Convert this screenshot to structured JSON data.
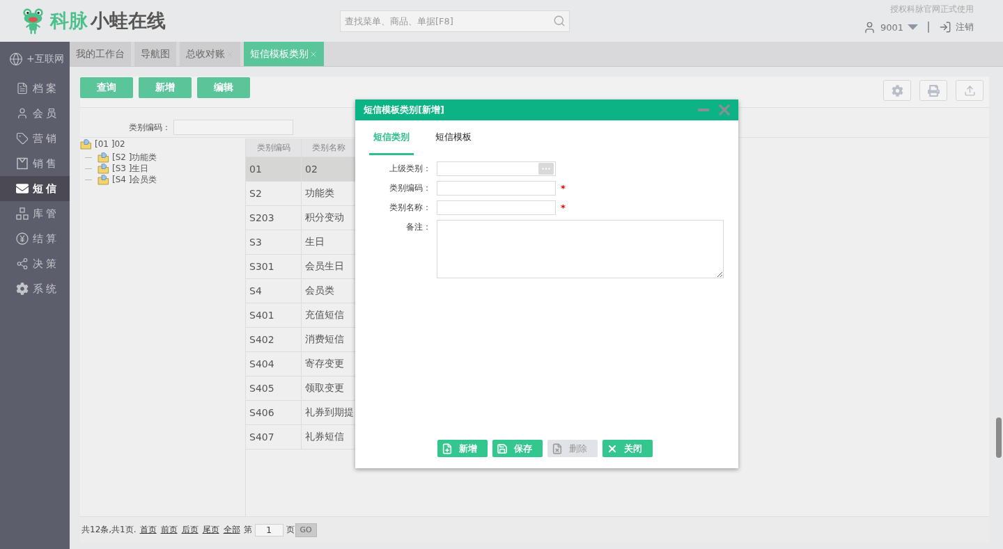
{
  "header": {
    "logo": {
      "brand": "科脉",
      "product": "小蛙在线"
    },
    "search": {
      "placeholder": "查找菜单、商品、单据[F8]"
    },
    "license_note": "授权科脉官网正式使用",
    "user": "9001",
    "logout": "注销"
  },
  "sidebar": {
    "top_item": "+互联网",
    "items": [
      {
        "label": "档案",
        "selected": false
      },
      {
        "label": "会员",
        "selected": false
      },
      {
        "label": "营销",
        "selected": false
      },
      {
        "label": "销售",
        "selected": false
      },
      {
        "label": "短信",
        "selected": true
      },
      {
        "label": "库管",
        "selected": false
      },
      {
        "label": "结算",
        "selected": false
      },
      {
        "label": "决策",
        "selected": false
      },
      {
        "label": "系统",
        "selected": false
      }
    ]
  },
  "tabs": [
    {
      "label": "我的工作台",
      "closable": false,
      "selected": false
    },
    {
      "label": "导航图",
      "closable": false,
      "selected": false
    },
    {
      "label": "总收对账",
      "closable": true,
      "selected": false
    },
    {
      "label": "短信模板类别",
      "closable": true,
      "selected": true
    }
  ],
  "toolbar": {
    "buttons": [
      "查询",
      "新增",
      "编辑"
    ]
  },
  "filter": {
    "label": "类别编码："
  },
  "tree": [
    {
      "label": "[01 ]02",
      "children": [
        {
          "label": "[S2 ]功能类"
        },
        {
          "label": "[S3 ]生日"
        },
        {
          "label": "[S4 ]会员类"
        }
      ]
    }
  ],
  "table": {
    "columns": [
      "类别编码",
      "类别名称"
    ],
    "rows": [
      {
        "code": "01",
        "name": "02",
        "selected": true
      },
      {
        "code": "S2",
        "name": "功能类",
        "selected": false
      },
      {
        "code": "S203",
        "name": "积分变动",
        "selected": false
      },
      {
        "code": "S3",
        "name": "生日",
        "selected": false
      },
      {
        "code": "S301",
        "name": "会员生日",
        "selected": false
      },
      {
        "code": "S4",
        "name": "会员类",
        "selected": false
      },
      {
        "code": "S401",
        "name": "充值短信",
        "selected": false
      },
      {
        "code": "S402",
        "name": "消费短信",
        "selected": false
      },
      {
        "code": "S404",
        "name": "寄存变更",
        "selected": false
      },
      {
        "code": "S405",
        "name": "领取变更",
        "selected": false
      },
      {
        "code": "S406",
        "name": "礼券到期提",
        "selected": false
      },
      {
        "code": "S407",
        "name": "礼券短信",
        "selected": false
      }
    ]
  },
  "pagination": {
    "summary": "共12条,共1页.",
    "links": [
      "首页",
      "前页",
      "后页",
      "尾页",
      "全部"
    ],
    "page_label": "第",
    "page": "1",
    "page_unit": "页",
    "go": "GO"
  },
  "dialog": {
    "title": "短信模板类别[新增]",
    "tabs": [
      {
        "label": "短信类别",
        "selected": true
      },
      {
        "label": "短信模板",
        "selected": false
      }
    ],
    "fields": [
      {
        "label": "上级类别：",
        "kind": "picker"
      },
      {
        "label": "类别编码：",
        "kind": "text",
        "required_mark": "*"
      },
      {
        "label": "类别名称：",
        "kind": "text",
        "required_mark": "*"
      },
      {
        "label": "备注：",
        "kind": "textarea"
      }
    ],
    "buttons": [
      {
        "label": "新增",
        "kind": "add",
        "disabled": false
      },
      {
        "label": "保存",
        "kind": "save",
        "disabled": false
      },
      {
        "label": "删除",
        "kind": "delete",
        "disabled": true
      },
      {
        "label": "关闭",
        "kind": "close",
        "disabled": false
      }
    ]
  }
}
